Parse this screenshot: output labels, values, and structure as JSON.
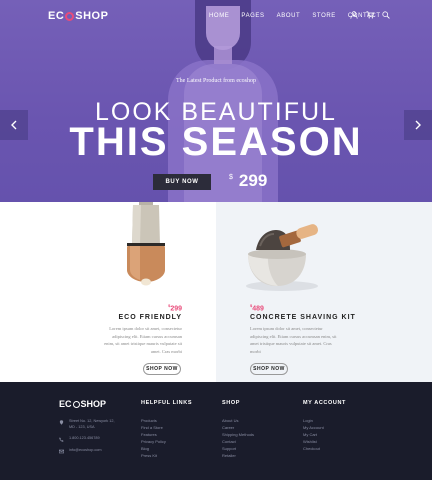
{
  "header": {
    "logo_prefix": "EC",
    "logo_suffix": "SHOP",
    "nav": [
      "HOME",
      "PAGES",
      "ABOUT",
      "STORE",
      "CONTACT"
    ]
  },
  "hero": {
    "tagline": "The Latest Product from ecoshop",
    "line1": "LOOK BEAUTIFUL",
    "line2": "THIS SEASON",
    "button": "BUY NOW",
    "currency": "$",
    "price": "299"
  },
  "products": [
    {
      "currency": "$",
      "price": "299",
      "title": "ECO FRIENDLY",
      "desc": "Lorem ipsum dolor sit amet, consectetur adipiscing elit. Etiam cursus accumsan enim, sit amet tristique mauris vulputate sit amet. Cras morbi",
      "button": "SHOP NOW"
    },
    {
      "currency": "$",
      "price": "489",
      "title": "CONCRETE SHAVING KIT",
      "desc": "Lorem ipsum dolor sit amet, consectetur adipiscing elit. Etiam cursus accumsan enim, sit amet tristique mauris vulputate sit amet. Cras morbi",
      "button": "SHOP NOW"
    }
  ],
  "footer": {
    "logo_prefix": "EC",
    "logo_suffix": "SHOP",
    "contact": {
      "address": "Street No. 12, Newyork 12,\nMD - 123, USA",
      "phone": "1.800.123.456789",
      "email": "info@ecoshop.com"
    },
    "helpful_links": {
      "title": "HELPFUL LINKS",
      "items": [
        "Products",
        "Find a Store",
        "Features",
        "Privacy Policy",
        "Blog",
        "Press Kit"
      ]
    },
    "shop": {
      "title": "SHOP",
      "items": [
        "About Us",
        "Career",
        "Shipping Methods",
        "Contact",
        "Support",
        "Retailer"
      ]
    },
    "my_account": {
      "title": "MY ACCOUNT",
      "items": [
        "Login",
        "My Account",
        "My Cart",
        "Wishlist",
        "Checkout"
      ]
    }
  },
  "colors": {
    "hero_bg": "#6b56b1",
    "accent": "#e94b7a",
    "button_dark": "#2c2c3a",
    "footer_bg": "#1a1c2b"
  },
  "icons": [
    "user-icon",
    "cart-icon",
    "search-icon",
    "chevron-left-icon",
    "chevron-right-icon",
    "map-pin-icon",
    "phone-icon",
    "mail-icon"
  ]
}
